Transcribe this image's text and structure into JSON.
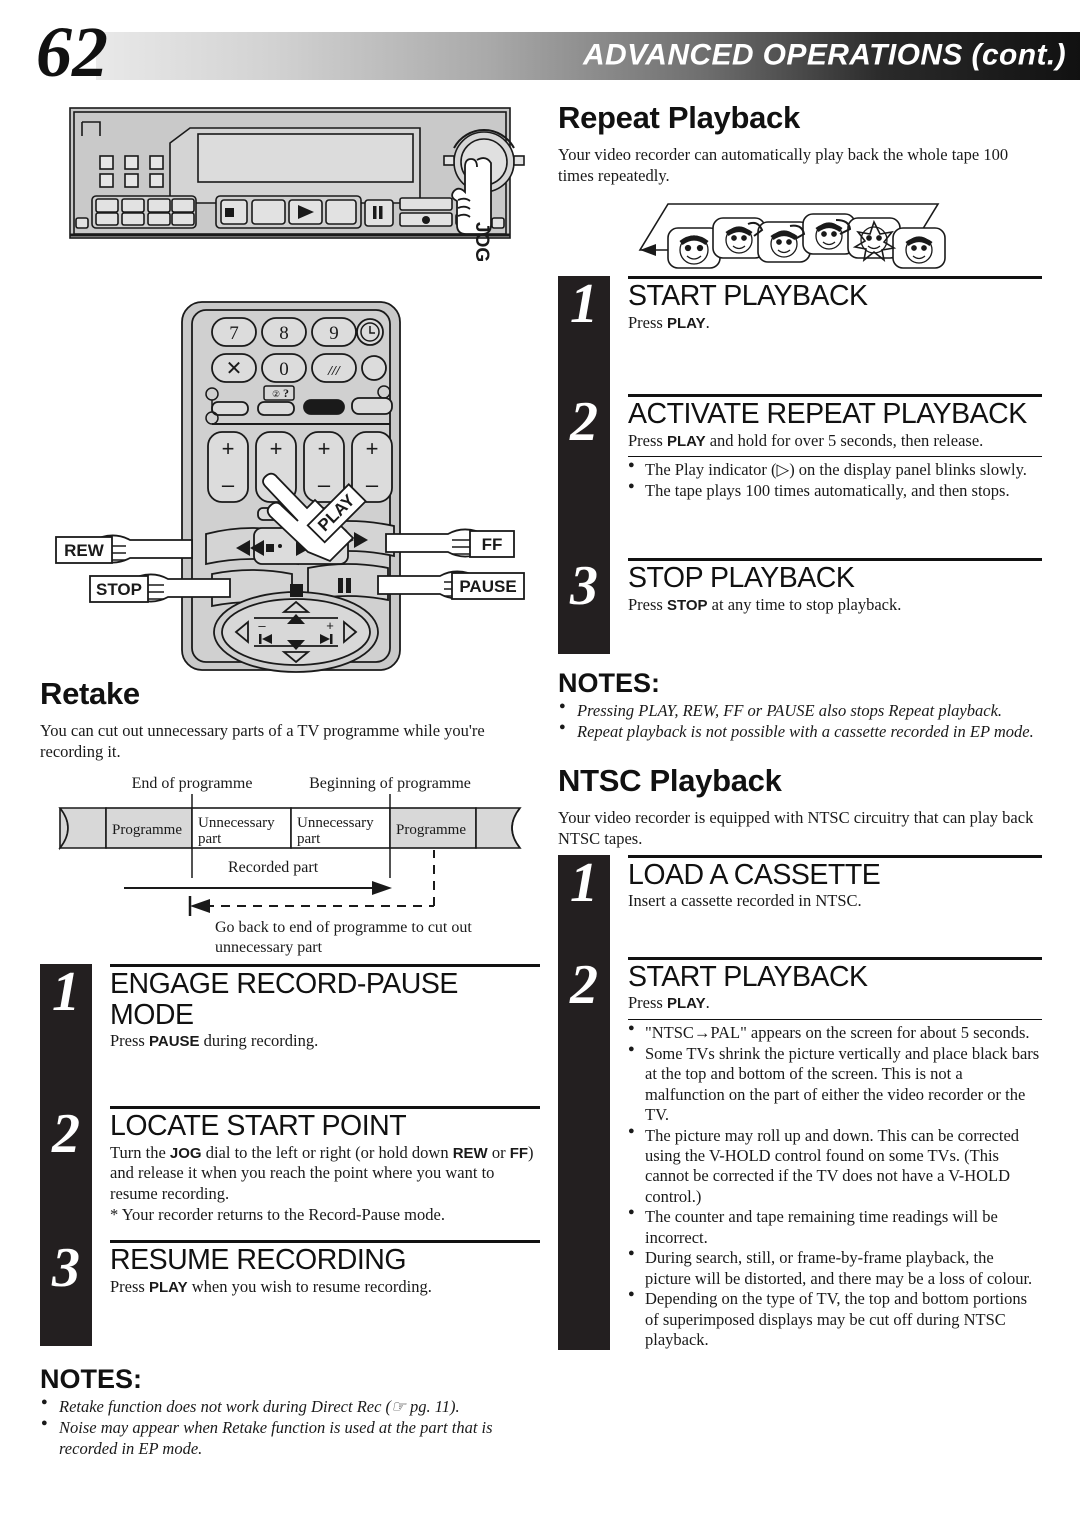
{
  "header": {
    "page_number": "62",
    "title": "ADVANCED OPERATIONS (cont.)"
  },
  "vcr_figure": {
    "jog_label": "JOG"
  },
  "remote_figure": {
    "keys": [
      "7",
      "8",
      "9",
      "X",
      "0"
    ],
    "callouts": {
      "play": "PLAY",
      "rew": "REW",
      "ff": "FF",
      "stop": "STOP",
      "pause": "PAUSE"
    }
  },
  "retake": {
    "title": "Retake",
    "intro": "You can cut out unnecessary parts of a TV programme while you're recording it.",
    "diagram": {
      "label_end": "End of programme",
      "label_begin": "Beginning of programme",
      "cells": [
        "Programme",
        "Unnecessary part",
        "Unnecessary part",
        "Programme"
      ],
      "recorded_label": "Recorded part",
      "goback_label": "Go back to end of programme to cut out unnecessary part"
    },
    "steps": [
      {
        "number": "1",
        "head": "ENGAGE RECORD-PAUSE MODE",
        "body_pre": "Press ",
        "body_bold": "PAUSE",
        "body_post": " during recording."
      },
      {
        "number": "2",
        "head": "LOCATE START POINT",
        "body_parts": [
          {
            "t": "Turn the ",
            "b": false
          },
          {
            "t": "JOG",
            "b": true
          },
          {
            "t": " dial to the left or right (or hold down ",
            "b": false
          },
          {
            "t": "REW",
            "b": true
          },
          {
            "t": " or ",
            "b": false
          },
          {
            "t": "FF",
            "b": true
          },
          {
            "t": ") and release it when you reach the point where you want to resume recording.",
            "b": false
          }
        ],
        "note": "*  Your recorder returns to the Record-Pause mode."
      },
      {
        "number": "3",
        "head": "RESUME RECORDING",
        "body_pre": "Press ",
        "body_bold": "PLAY",
        "body_post": " when you wish to resume recording."
      }
    ],
    "notes_title": "NOTES:",
    "notes": [
      "Retake function does not work during Direct Rec (☞ pg. 11).",
      "Noise may appear when Retake function is used at the part that is recorded in EP mode."
    ]
  },
  "repeat_playback": {
    "title": "Repeat Playback",
    "intro": "Your video recorder can automatically play back the whole tape 100 times repeatedly.",
    "steps": [
      {
        "number": "1",
        "head": "START PLAYBACK",
        "body_pre": "Press ",
        "body_bold": "PLAY",
        "body_post": "."
      },
      {
        "number": "2",
        "head": "ACTIVATE REPEAT PLAYBACK",
        "body_pre": "Press ",
        "body_bold": "PLAY",
        "body_post": " and hold for over 5 seconds, then release.",
        "bullets": [
          "The Play indicator (▷) on the display panel blinks slowly.",
          "The tape plays 100 times automatically, and then stops."
        ]
      },
      {
        "number": "3",
        "head": "STOP PLAYBACK",
        "body_pre": "Press ",
        "body_bold": "STOP",
        "body_post": " at any time to stop playback."
      }
    ],
    "notes_title": "NOTES:",
    "notes": [
      "Pressing PLAY, REW, FF or PAUSE also stops Repeat playback.",
      "Repeat playback is not possible with a cassette recorded in EP mode."
    ]
  },
  "ntsc_playback": {
    "title": "NTSC Playback",
    "intro": "Your video recorder is equipped with NTSC circuitry that can play back NTSC tapes.",
    "steps": [
      {
        "number": "1",
        "head": "LOAD A CASSETTE",
        "body": "Insert a cassette recorded in NTSC."
      },
      {
        "number": "2",
        "head": "START PLAYBACK",
        "body_pre": "Press ",
        "body_bold": "PLAY",
        "body_post": ".",
        "bullets": [
          "\"NTSC→PAL\" appears on the screen for about 5 seconds.",
          "Some TVs shrink the picture vertically and place black bars at the top and bottom of the screen. This is not a malfunction on the part of either the video recorder or the TV.",
          "The picture may roll up and down. This can be corrected using the V-HOLD control found on some TVs. (This cannot be corrected if the TV does not have a V-HOLD control.)",
          "The counter and tape remaining time readings will be incorrect.",
          "During search, still, or frame-by-frame playback, the picture will be distorted, and there may be a loss of colour.",
          "Depending on the type of TV, the top and bottom portions of superimposed displays may be cut off during NTSC playback."
        ]
      }
    ]
  },
  "colors": {
    "ink": "#231f20",
    "panel_gray": "#c9c9c9",
    "cell_gray": "#d8d8d8"
  }
}
